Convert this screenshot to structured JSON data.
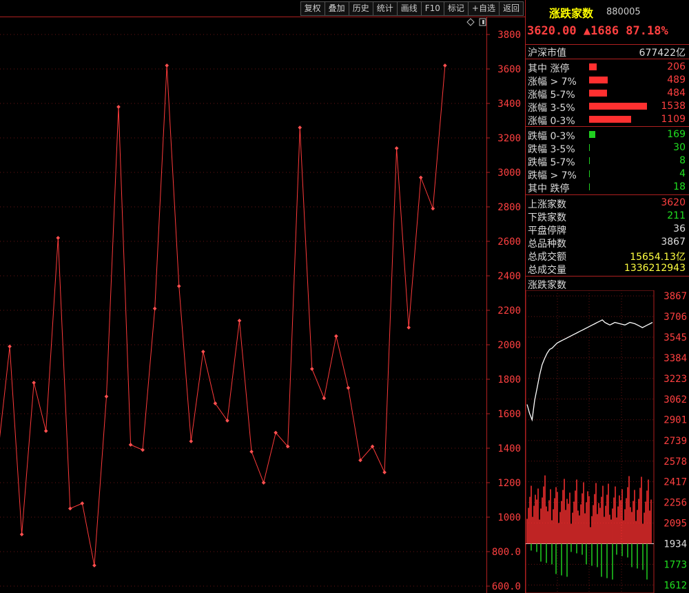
{
  "toolbar": [
    "复权",
    "叠加",
    "历史",
    "统计",
    "画线",
    "F10",
    "标记",
    "+自选",
    "返回"
  ],
  "icons": {
    "diamond": "diamond-icon",
    "window": "window-icon"
  },
  "panel": {
    "title": "涨跌家数",
    "code": "880005",
    "price_line": "3620.00 ▲1686 87.18%",
    "market_cap": {
      "label": "沪深市值",
      "value": "677422亿"
    },
    "up_rows": [
      {
        "label": "其中 涨停",
        "value": "206",
        "bar_value": 206
      },
      {
        "label": "涨幅 > 7%",
        "value": "489",
        "bar_value": 489
      },
      {
        "label": "涨幅 5-7%",
        "value": "484",
        "bar_value": 484
      },
      {
        "label": "涨幅 3-5%",
        "value": "1538",
        "bar_value": 1538
      },
      {
        "label": "涨幅 0-3%",
        "value": "1109",
        "bar_value": 1109
      }
    ],
    "down_rows": [
      {
        "label": "跌幅 0-3%",
        "value": "169",
        "bar_value": 169
      },
      {
        "label": "跌幅 3-5%",
        "value": "30",
        "bar_value": 30
      },
      {
        "label": "跌幅 5-7%",
        "value": "8",
        "bar_value": 8
      },
      {
        "label": "跌幅 > 7%",
        "value": "4",
        "bar_value": 4
      },
      {
        "label": "其中 跌停",
        "value": "18",
        "bar_value": 18
      }
    ],
    "stats": [
      {
        "label": "上涨家数",
        "value": "3620",
        "color": "#ff4040"
      },
      {
        "label": "下跌家数",
        "value": "211",
        "color": "#20e020"
      },
      {
        "label": "平盘停牌",
        "value": "36",
        "color": "#dddddd"
      },
      {
        "label": "总品种数",
        "value": "3867",
        "color": "#dddddd"
      },
      {
        "label": "总成交额",
        "value": "15654.13亿",
        "color": "#ffff40"
      },
      {
        "label": "总成交量",
        "value": "1336212943",
        "color": "#ffff40"
      }
    ],
    "mini_label": "涨跌家数"
  },
  "chart_data": [
    {
      "type": "line",
      "ylim": [
        560,
        3900
      ],
      "y_ticks": [
        "3800",
        "3600",
        "3400",
        "3200",
        "3000",
        "2800",
        "2600",
        "2400",
        "2200",
        "2000",
        "1800",
        "1600",
        "1400",
        "1200",
        "1000",
        "800.0",
        "600.0"
      ],
      "values": [
        1350,
        1990,
        900,
        1780,
        1500,
        2620,
        1050,
        1080,
        720,
        1700,
        3380,
        1420,
        1390,
        2210,
        3620,
        2340,
        1440,
        1960,
        1660,
        1560,
        2140,
        1380,
        1200,
        1490,
        1410,
        3260,
        1860,
        1690,
        2050,
        1750,
        1330,
        1410,
        1260,
        3140,
        2100,
        2970,
        2790,
        3620
      ]
    },
    {
      "type": "line",
      "y_ticks": [
        "3867",
        "3706",
        "3545",
        "3384",
        "3223",
        "3062",
        "2901",
        "2739",
        "2578",
        "2417",
        "2256",
        "2095",
        "1934",
        "1773",
        "1612"
      ],
      "ylim": [
        1560,
        3900
      ],
      "values": [
        3020,
        2950,
        2900,
        3050,
        3150,
        3250,
        3330,
        3380,
        3420,
        3450,
        3460,
        3480,
        3500,
        3510,
        3520,
        3530,
        3540,
        3550,
        3560,
        3570,
        3580,
        3590,
        3600,
        3610,
        3620,
        3630,
        3640,
        3650,
        3660,
        3670,
        3680,
        3660,
        3650,
        3640,
        3650,
        3660,
        3655,
        3650,
        3645,
        3640,
        3650,
        3660,
        3655,
        3650,
        3640,
        3630,
        3620,
        3630,
        3640,
        3650,
        3660
      ]
    }
  ]
}
